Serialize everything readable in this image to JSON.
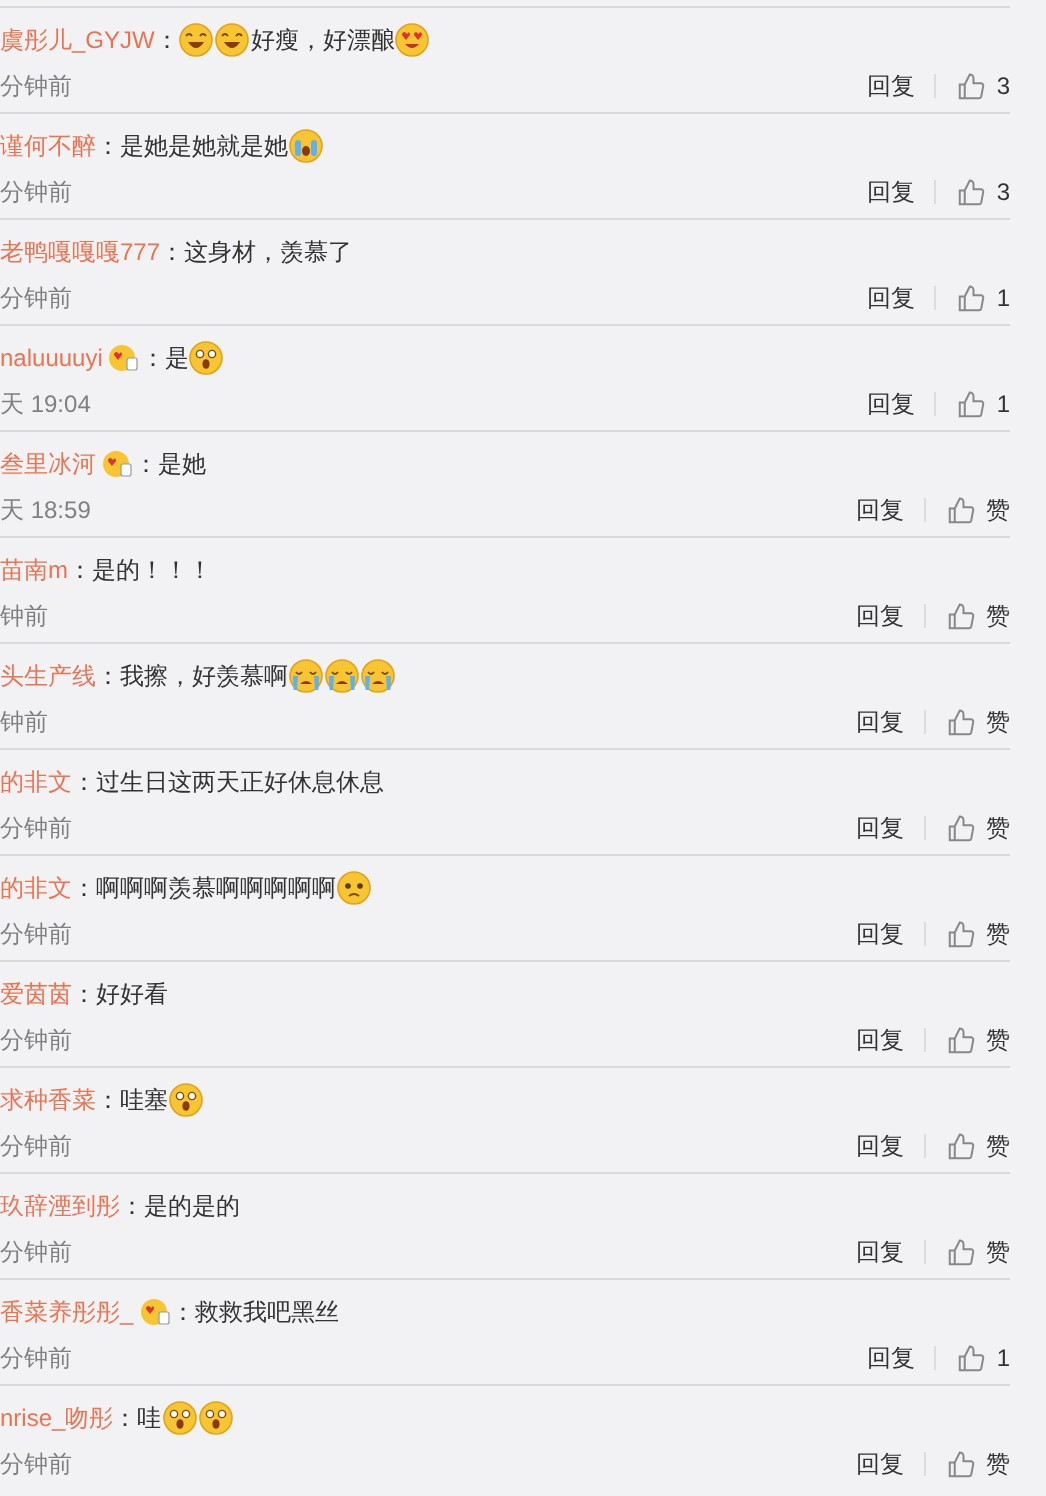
{
  "comments": [
    {
      "name": "虞彤儿_GYJW",
      "badge": false,
      "parts": [
        {
          "kind": "text",
          "text": "："
        },
        {
          "kind": "grin"
        },
        {
          "kind": "grin"
        },
        {
          "kind": "text",
          "text": "好瘦，好漂酿"
        },
        {
          "kind": "hearts"
        }
      ],
      "time": "分钟前",
      "reply": "回复",
      "likes": "3"
    },
    {
      "name": "谨何不醉",
      "badge": false,
      "parts": [
        {
          "kind": "text",
          "text": "：是她是她就是她"
        },
        {
          "kind": "tears"
        }
      ],
      "time": "分钟前",
      "reply": "回复",
      "likes": "3"
    },
    {
      "name": "老鸭嘎嘎嘎777",
      "badge": false,
      "parts": [
        {
          "kind": "text",
          "text": "：这身材，羡慕了"
        }
      ],
      "time": "分钟前",
      "reply": "回复",
      "likes": "1"
    },
    {
      "name": "naluuuuyi",
      "badge": true,
      "parts": [
        {
          "kind": "text",
          "text": "：是"
        },
        {
          "kind": "shock"
        }
      ],
      "time": "天 19:04",
      "reply": "回复",
      "likes": "1"
    },
    {
      "name": "叁里冰河",
      "badge": true,
      "parts": [
        {
          "kind": "text",
          "text": "：是她"
        }
      ],
      "time": "天 18:59",
      "reply": "回复",
      "likes": "赞"
    },
    {
      "name": "苗南m",
      "badge": false,
      "parts": [
        {
          "kind": "text",
          "text": "：是的！！！"
        }
      ],
      "time": "钟前",
      "reply": "回复",
      "likes": "赞"
    },
    {
      "name": "头生产线",
      "badge": false,
      "parts": [
        {
          "kind": "text",
          "text": "：我擦，好羡慕啊"
        },
        {
          "kind": "cry"
        },
        {
          "kind": "cry"
        },
        {
          "kind": "cry"
        }
      ],
      "time": "钟前",
      "reply": "回复",
      "likes": "赞"
    },
    {
      "name": "的非文",
      "badge": false,
      "parts": [
        {
          "kind": "text",
          "text": "：过生日这两天正好休息休息"
        }
      ],
      "time": "分钟前",
      "reply": "回复",
      "likes": "赞"
    },
    {
      "name": "的非文",
      "badge": false,
      "parts": [
        {
          "kind": "text",
          "text": "：啊啊啊羡慕啊啊啊啊啊"
        },
        {
          "kind": "worried"
        }
      ],
      "time": "分钟前",
      "reply": "回复",
      "likes": "赞"
    },
    {
      "name": "爱茵茵",
      "badge": false,
      "parts": [
        {
          "kind": "text",
          "text": "：好好看"
        }
      ],
      "time": "分钟前",
      "reply": "回复",
      "likes": "赞"
    },
    {
      "name": "求种香菜",
      "badge": false,
      "parts": [
        {
          "kind": "text",
          "text": "：哇塞"
        },
        {
          "kind": "shock"
        }
      ],
      "time": "分钟前",
      "reply": "回复",
      "likes": "赞"
    },
    {
      "name": "玖辞湮到彤",
      "badge": false,
      "parts": [
        {
          "kind": "text",
          "text": "：是的是的"
        }
      ],
      "time": "分钟前",
      "reply": "回复",
      "likes": "赞"
    },
    {
      "name": "香菜养彤彤_",
      "badge": true,
      "parts": [
        {
          "kind": "text",
          "text": "：救救我吧黑丝"
        }
      ],
      "time": "分钟前",
      "reply": "回复",
      "likes": "1"
    },
    {
      "name": "nrise_吻彤",
      "badge": false,
      "parts": [
        {
          "kind": "text",
          "text": "：哇"
        },
        {
          "kind": "shock"
        },
        {
          "kind": "shock"
        }
      ],
      "time": "分钟前",
      "reply": "回复",
      "likes": "赞"
    }
  ]
}
